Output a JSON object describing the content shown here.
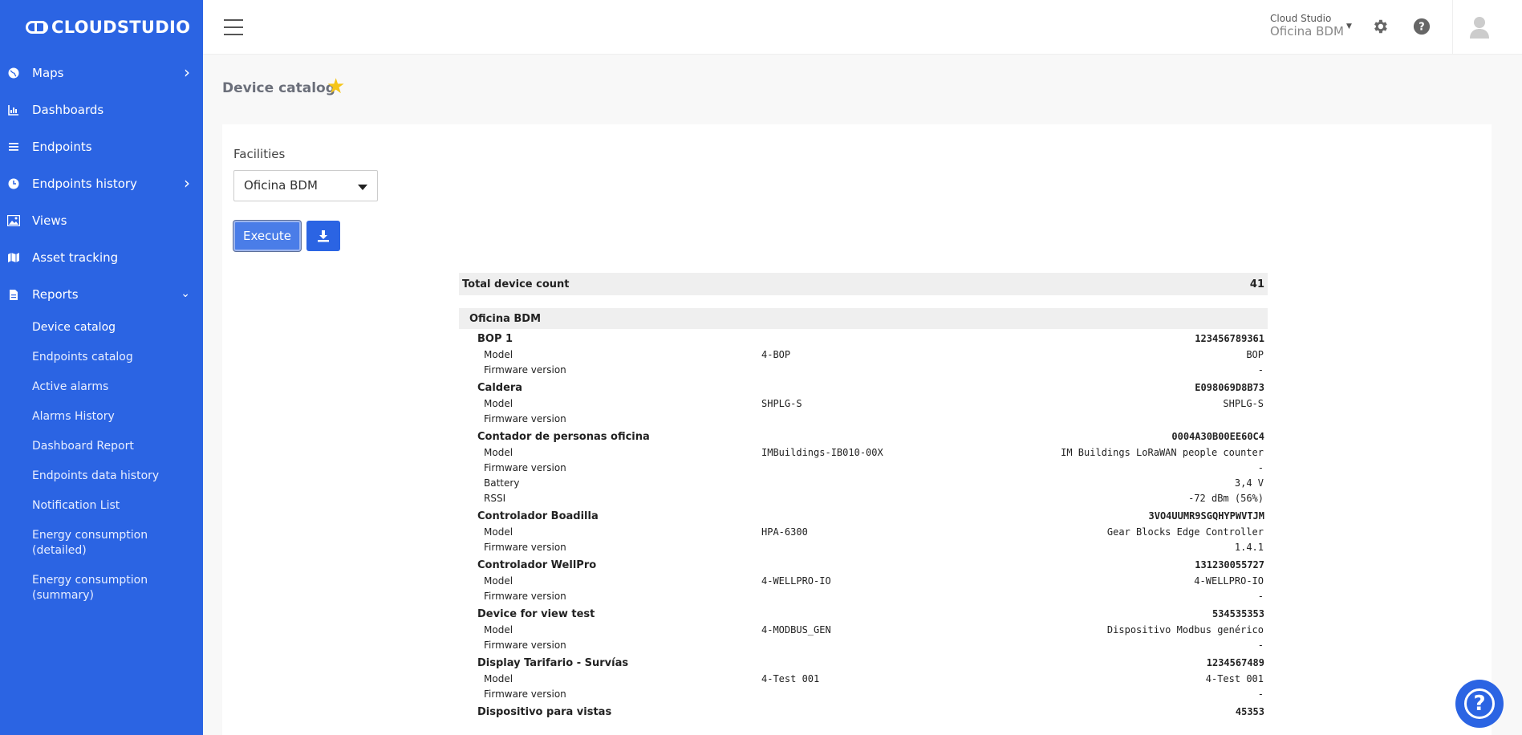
{
  "brand": {
    "name": "CLOUDSTUDIO"
  },
  "sidebar": {
    "items": [
      {
        "label": "Maps",
        "icon": "globe-icon",
        "has_chevron": true
      },
      {
        "label": "Dashboards",
        "icon": "chart-icon",
        "has_chevron": false
      },
      {
        "label": "Endpoints",
        "icon": "list-icon",
        "has_chevron": false
      },
      {
        "label": "Endpoints history",
        "icon": "clock-icon",
        "has_chevron": true
      },
      {
        "label": "Views",
        "icon": "image-icon",
        "has_chevron": false
      },
      {
        "label": "Asset tracking",
        "icon": "map-icon",
        "has_chevron": false
      },
      {
        "label": "Reports",
        "icon": "file-icon",
        "has_chevron": true,
        "expanded": true
      }
    ],
    "report_subitems": [
      "Device catalog",
      "Endpoints catalog",
      "Active alarms",
      "Alarms History",
      "Dashboard Report",
      "Endpoints data history",
      "Notification List",
      "Energy consumption (detailed)",
      "Energy consumption (summary)"
    ]
  },
  "topbar": {
    "org_top": "Cloud Studio",
    "org_name": "Oficina BDM"
  },
  "page": {
    "title": "Device catalog",
    "facilities_label": "Facilities",
    "facility_selected": "Oficina BDM",
    "execute_label": "Execute"
  },
  "report": {
    "total_label": "Total device count",
    "total_value": "41",
    "facility": "Oficina BDM",
    "devices": [
      {
        "name": "BOP 1",
        "serial": "123456789361",
        "attrs": [
          {
            "name": "Model",
            "mid": "4-BOP",
            "value": "BOP"
          },
          {
            "name": "Firmware version",
            "mid": "",
            "value": "-"
          }
        ]
      },
      {
        "name": "Caldera",
        "serial": "E098069D8B73",
        "attrs": [
          {
            "name": "Model",
            "mid": "SHPLG-S",
            "value": "SHPLG-S"
          },
          {
            "name": "Firmware version",
            "mid": "",
            "value": ""
          }
        ]
      },
      {
        "name": "Contador de personas oficina",
        "serial": "0004A30B00EE60C4",
        "attrs": [
          {
            "name": "Model",
            "mid": "IMBuildings-IB010-00X",
            "value": "IM Buildings LoRaWAN people counter"
          },
          {
            "name": "Firmware version",
            "mid": "",
            "value": "-"
          },
          {
            "name": "Battery",
            "mid": "",
            "value": "3,4 V"
          },
          {
            "name": "RSSI",
            "mid": "",
            "value": "-72 dBm (56%)"
          }
        ]
      },
      {
        "name": "Controlador Boadilla",
        "serial": "3VO4UUMR9SGQHYPWVTJM",
        "attrs": [
          {
            "name": "Model",
            "mid": "HPA-6300",
            "value": "Gear Blocks Edge Controller"
          },
          {
            "name": "Firmware version",
            "mid": "",
            "value": "1.4.1"
          }
        ]
      },
      {
        "name": "Controlador WellPro",
        "serial": "131230055727",
        "attrs": [
          {
            "name": "Model",
            "mid": "4-WELLPRO-IO",
            "value": "4-WELLPRO-IO"
          },
          {
            "name": "Firmware version",
            "mid": "",
            "value": "-"
          }
        ]
      },
      {
        "name": "Device for view test",
        "serial": "534535353",
        "attrs": [
          {
            "name": "Model",
            "mid": "4-MODBUS_GEN",
            "value": "Dispositivo Modbus genérico"
          },
          {
            "name": "Firmware version",
            "mid": "",
            "value": "-"
          }
        ]
      },
      {
        "name": "Display Tarifario - Survías",
        "serial": "1234567489",
        "attrs": [
          {
            "name": "Model",
            "mid": "4-Test 001",
            "value": "4-Test 001"
          },
          {
            "name": "Firmware version",
            "mid": "",
            "value": "-"
          }
        ]
      },
      {
        "name": "Dispositivo para vistas",
        "serial": "45353",
        "attrs": []
      }
    ]
  }
}
